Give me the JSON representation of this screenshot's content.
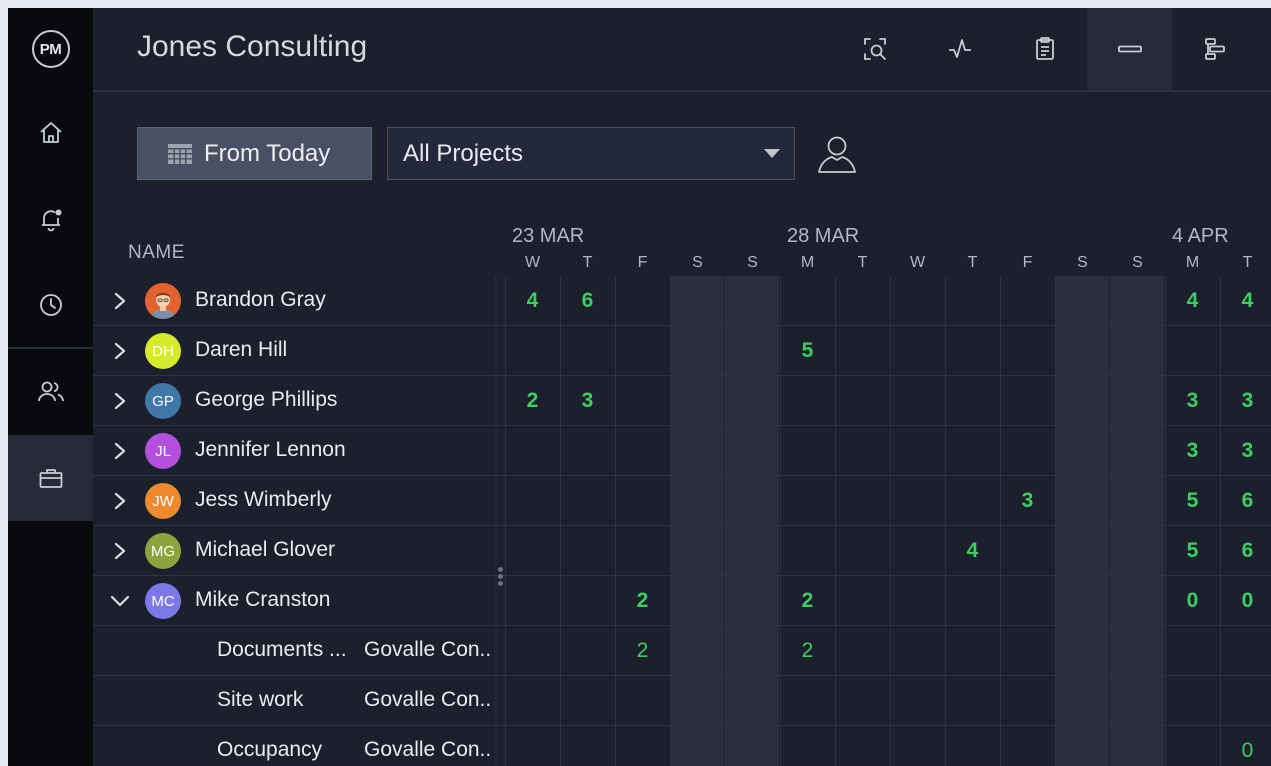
{
  "logo": "PM",
  "app_title": "Jones Consulting",
  "rail_icons": [
    "home-icon",
    "bell-icon",
    "clock-icon",
    "people-icon",
    "briefcase-icon"
  ],
  "top_icons": [
    "search-zoom-icon",
    "pulse-icon",
    "clipboard-icon",
    "minus-bar-icon",
    "gantt-icon"
  ],
  "toolbar": {
    "from_today_label": "From Today",
    "project_select": "All Projects"
  },
  "columns": {
    "name_header": "NAME"
  },
  "months": [
    {
      "label": "23 MAR",
      "col": 0
    },
    {
      "label": "28 MAR",
      "col": 5
    },
    {
      "label": "4 APR",
      "col": 12
    }
  ],
  "days": [
    "W",
    "T",
    "F",
    "S",
    "S",
    "M",
    "T",
    "W",
    "T",
    "F",
    "S",
    "S",
    "M",
    "T"
  ],
  "weekend_cols": [
    3,
    4,
    10,
    11
  ],
  "rows": [
    {
      "type": "person",
      "name": "Brandon Gray",
      "initials": "",
      "photo": true,
      "color": "#e4622e",
      "expanded": false,
      "values": [
        "4",
        "6",
        "",
        "",
        "",
        "",
        "",
        "",
        "",
        "",
        "",
        "",
        "4",
        "4"
      ]
    },
    {
      "type": "person",
      "name": "Daren Hill",
      "initials": "DH",
      "color": "#d6ea2a",
      "expanded": false,
      "values": [
        "",
        "",
        "",
        "",
        "",
        "5",
        "",
        "",
        "",
        "",
        "",
        "",
        "",
        ""
      ]
    },
    {
      "type": "person",
      "name": "George Phillips",
      "initials": "GP",
      "color": "#3f78a6",
      "expanded": false,
      "values": [
        "2",
        "3",
        "",
        "",
        "",
        "",
        "",
        "",
        "",
        "",
        "",
        "",
        "3",
        "3"
      ]
    },
    {
      "type": "person",
      "name": "Jennifer Lennon",
      "initials": "JL",
      "color": "#b34fdc",
      "expanded": false,
      "values": [
        "",
        "",
        "",
        "",
        "",
        "",
        "",
        "",
        "",
        "",
        "",
        "",
        "3",
        "3"
      ]
    },
    {
      "type": "person",
      "name": "Jess Wimberly",
      "initials": "JW",
      "color": "#ed8a2e",
      "expanded": false,
      "values": [
        "",
        "",
        "",
        "",
        "",
        "",
        "",
        "",
        "",
        "3",
        "",
        "",
        "5",
        "6"
      ]
    },
    {
      "type": "person",
      "name": "Michael Glover",
      "initials": "MG",
      "color": "#8ea33c",
      "expanded": false,
      "values": [
        "",
        "",
        "",
        "",
        "",
        "",
        "",
        "",
        "4",
        "",
        "",
        "",
        "5",
        "6"
      ]
    },
    {
      "type": "person",
      "name": "Mike Cranston",
      "initials": "MC",
      "color": "#7d78e8",
      "expanded": true,
      "values": [
        "",
        "",
        "2",
        "",
        "",
        "2",
        "",
        "",
        "",
        "",
        "",
        "",
        "0",
        "0"
      ]
    },
    {
      "type": "task",
      "name": "Documents ...",
      "project": "Govalle Con..",
      "values": [
        "",
        "",
        "2",
        "",
        "",
        "2",
        "",
        "",
        "",
        "",
        "",
        "",
        "",
        ""
      ]
    },
    {
      "type": "task",
      "name": "Site work",
      "project": "Govalle Con..",
      "values": [
        "",
        "",
        "",
        "",
        "",
        "",
        "",
        "",
        "",
        "",
        "",
        "",
        "",
        ""
      ]
    },
    {
      "type": "task",
      "name": "Occupancy",
      "project": "Govalle Con..",
      "values": [
        "",
        "",
        "",
        "",
        "",
        "",
        "",
        "",
        "",
        "",
        "",
        "",
        "",
        "0"
      ]
    }
  ]
}
